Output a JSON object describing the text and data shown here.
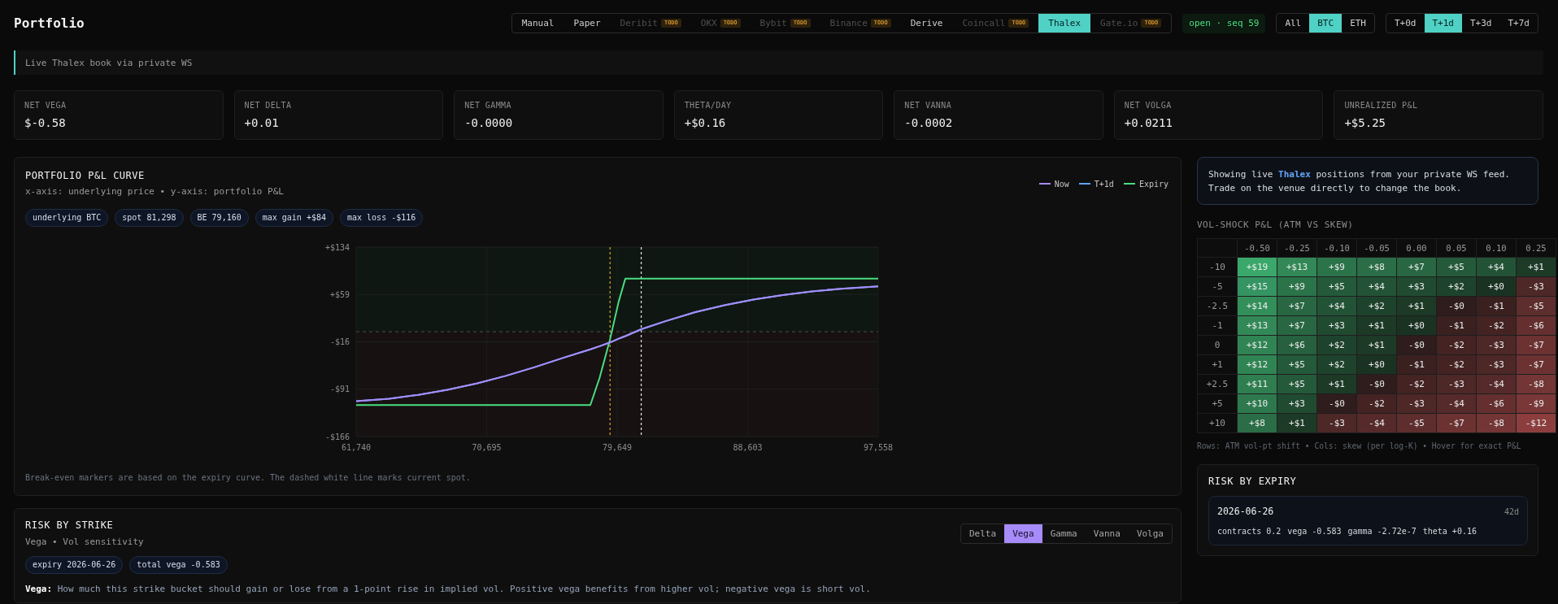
{
  "header": {
    "title": "Portfolio",
    "venues": [
      {
        "label": "Manual",
        "disabled": false,
        "selected": false
      },
      {
        "label": "Paper",
        "disabled": false,
        "selected": false
      },
      {
        "label": "Deribit",
        "badge": "TODO",
        "disabled": true,
        "selected": false
      },
      {
        "label": "OKX",
        "badge": "TODO",
        "disabled": true,
        "selected": false
      },
      {
        "label": "Bybit",
        "badge": "TODO",
        "disabled": true,
        "selected": false
      },
      {
        "label": "Binance",
        "badge": "TODO",
        "disabled": true,
        "selected": false
      },
      {
        "label": "Derive",
        "disabled": false,
        "selected": false
      },
      {
        "label": "Coincall",
        "badge": "TODO",
        "disabled": true,
        "selected": false
      },
      {
        "label": "Thalex",
        "disabled": false,
        "selected": true
      },
      {
        "label": "Gate.io",
        "badge": "TODO",
        "disabled": true,
        "selected": false
      }
    ],
    "status": "open · seq 59",
    "underlyings": [
      {
        "label": "All",
        "selected": false
      },
      {
        "label": "BTC",
        "selected": true
      },
      {
        "label": "ETH",
        "selected": false
      }
    ],
    "horizons": [
      {
        "label": "T+0d",
        "selected": false
      },
      {
        "label": "T+1d",
        "selected": true
      },
      {
        "label": "T+3d",
        "selected": false
      },
      {
        "label": "T+7d",
        "selected": false
      }
    ]
  },
  "banner": {
    "text": "Live Thalex book via private WS"
  },
  "stats": [
    {
      "label": "NET VEGA",
      "value": "$-0.58"
    },
    {
      "label": "NET DELTA",
      "value": "+0.01"
    },
    {
      "label": "NET GAMMA",
      "value": "-0.0000"
    },
    {
      "label": "THETA/DAY",
      "value": "+$0.16"
    },
    {
      "label": "NET VANNA",
      "value": "-0.0002"
    },
    {
      "label": "NET VOLGA",
      "value": "+0.0211"
    },
    {
      "label": "UNREALIZED P&L",
      "value": "+$5.25"
    }
  ],
  "pnl_curve": {
    "title": "PORTFOLIO P&L CURVE",
    "subtitle": "x-axis: underlying price • y-axis: portfolio P&L",
    "chips": [
      "underlying BTC",
      "spot 81,298",
      "BE 79,160",
      "max gain +$84",
      "max loss -$116"
    ],
    "chart_data": {
      "type": "line",
      "x": [
        61740,
        64000,
        66000,
        68000,
        70000,
        72000,
        74000,
        76000,
        77808,
        78444,
        79160,
        79744,
        80207,
        81298,
        83000,
        85000,
        87000,
        89000,
        91000,
        93000,
        95000,
        97558
      ],
      "series": [
        {
          "name": "Now",
          "color": "#a78bfa",
          "values": [
            -110,
            -106,
            -100,
            -92,
            -82,
            -70,
            -56,
            -41,
            -28,
            -23,
            -17,
            -11,
            -7,
            4,
            17,
            31,
            42,
            51,
            58,
            64,
            68,
            72
          ]
        },
        {
          "name": "T+1d",
          "color": "#60a5fa",
          "values": [
            -110,
            -106,
            -100,
            -92,
            -82,
            -70,
            -56,
            -41,
            -28,
            -23,
            -17,
            -11,
            -7,
            4,
            17,
            31,
            42,
            51,
            58,
            64,
            68,
            72
          ]
        },
        {
          "name": "Expiry",
          "color": "#4ade80",
          "values": [
            -116,
            -116,
            -116,
            -116,
            -116,
            -116,
            -116,
            -116,
            -116,
            -73,
            -12,
            47,
            84,
            84,
            84,
            84,
            84,
            84,
            84,
            84,
            84,
            84
          ]
        }
      ],
      "xlim": [
        61740,
        97558
      ],
      "ylim": [
        -166,
        134
      ],
      "xticks": [
        {
          "value": 61740,
          "label": "61,740"
        },
        {
          "value": 70695,
          "label": "70,695"
        },
        {
          "value": 79649,
          "label": "79,649"
        },
        {
          "value": 88603,
          "label": "88,603"
        },
        {
          "value": 97558,
          "label": "97,558"
        }
      ],
      "yticks": [
        {
          "value": 134,
          "label": "+$134"
        },
        {
          "value": 59,
          "label": "+$59"
        },
        {
          "value": -16,
          "label": "-$16"
        },
        {
          "value": -91,
          "label": "-$91"
        },
        {
          "value": -166,
          "label": "-$166"
        }
      ],
      "grid": true,
      "ref_lines": [
        {
          "axis": "y",
          "value": 0,
          "color": "#4d4d4d"
        },
        {
          "axis": "x",
          "value": 79160,
          "color": "#d4a72c"
        },
        {
          "axis": "x",
          "value": 81298,
          "color": "#e8e8e8"
        }
      ]
    },
    "note": "Break-even markers are based on the expiry curve. The dashed white line marks current spot."
  },
  "risk_by_strike": {
    "title": "RISK BY STRIKE",
    "subtitle": "Vega • Vol sensitivity",
    "tabs": [
      {
        "label": "Delta",
        "selected": false
      },
      {
        "label": "Vega",
        "selected": true
      },
      {
        "label": "Gamma",
        "selected": false
      },
      {
        "label": "Vanna",
        "selected": false
      },
      {
        "label": "Volga",
        "selected": false
      }
    ],
    "chips": [
      "expiry 2026-06-26",
      "total vega -0.583"
    ],
    "description": "**Vega:** How much this strike bucket should gain or lose from a 1-point rise in implied vol. Positive vega benefits from higher vol; negative vega is short vol."
  },
  "info": {
    "text": "Showing live **Thalex** positions from your private WS feed. Trade on the venue directly to change the book."
  },
  "vol_shock": {
    "title": "VOL-SHOCK P&L (ATM VS SKEW)",
    "columns": [
      "-0.50",
      "-0.25",
      "-0.10",
      "-0.05",
      "0.00",
      "0.05",
      "0.10",
      "0.25"
    ],
    "rows": [
      {
        "label": "-10",
        "cells": [
          {
            "value": "+$19",
            "color": "#3aa86a"
          },
          {
            "value": "+$13",
            "color": "#328957"
          },
          {
            "value": "+$9",
            "color": "#2b7349"
          },
          {
            "value": "+$8",
            "color": "#2a6d46"
          },
          {
            "value": "+$7",
            "color": "#286742"
          },
          {
            "value": "+$5",
            "color": "#245a3a"
          },
          {
            "value": "+$4",
            "color": "#235336"
          },
          {
            "value": "+$1",
            "color": "#1c3a26"
          }
        ]
      },
      {
        "label": "-5",
        "cells": [
          {
            "value": "+$15",
            "color": "#349462"
          },
          {
            "value": "+$9",
            "color": "#2b7349"
          },
          {
            "value": "+$5",
            "color": "#245a3a"
          },
          {
            "value": "+$4",
            "color": "#235336"
          },
          {
            "value": "+$3",
            "color": "#204b31"
          },
          {
            "value": "+$2",
            "color": "#1e432c"
          },
          {
            "value": "+$0",
            "color": "#1a3222"
          },
          {
            "value": "-$3",
            "color": "#4e2727"
          }
        ]
      },
      {
        "label": "-2.5",
        "cells": [
          {
            "value": "+$14",
            "color": "#338f5a"
          },
          {
            "value": "+$7",
            "color": "#286742"
          },
          {
            "value": "+$4",
            "color": "#235336"
          },
          {
            "value": "+$2",
            "color": "#1e432c"
          },
          {
            "value": "+$1",
            "color": "#1c3a26"
          },
          {
            "value": "-$0",
            "color": "#2f1c1c"
          },
          {
            "value": "-$1",
            "color": "#3b2020"
          },
          {
            "value": "-$5",
            "color": "#5e2d2d"
          }
        ]
      },
      {
        "label": "-1",
        "cells": [
          {
            "value": "+$13",
            "color": "#328957"
          },
          {
            "value": "+$7",
            "color": "#286742"
          },
          {
            "value": "+$3",
            "color": "#204b31"
          },
          {
            "value": "+$1",
            "color": "#1c3a26"
          },
          {
            "value": "+$0",
            "color": "#1a3222"
          },
          {
            "value": "-$1",
            "color": "#3b2020"
          },
          {
            "value": "-$2",
            "color": "#452323"
          },
          {
            "value": "-$6",
            "color": "#652f2f"
          }
        ]
      },
      {
        "label": "0",
        "cells": [
          {
            "value": "+$12",
            "color": "#308454"
          },
          {
            "value": "+$6",
            "color": "#26603e"
          },
          {
            "value": "+$2",
            "color": "#1e432c"
          },
          {
            "value": "+$1",
            "color": "#1c3a26"
          },
          {
            "value": "-$0",
            "color": "#2f1c1c"
          },
          {
            "value": "-$2",
            "color": "#452323"
          },
          {
            "value": "-$3",
            "color": "#4e2727"
          },
          {
            "value": "-$7",
            "color": "#6c3232"
          }
        ]
      },
      {
        "label": "+1",
        "cells": [
          {
            "value": "+$12",
            "color": "#308454"
          },
          {
            "value": "+$5",
            "color": "#245a3a"
          },
          {
            "value": "+$2",
            "color": "#1e432c"
          },
          {
            "value": "+$0",
            "color": "#1a3222"
          },
          {
            "value": "-$1",
            "color": "#3b2020"
          },
          {
            "value": "-$2",
            "color": "#452323"
          },
          {
            "value": "-$3",
            "color": "#4e2727"
          },
          {
            "value": "-$7",
            "color": "#6c3232"
          }
        ]
      },
      {
        "label": "+2.5",
        "cells": [
          {
            "value": "+$11",
            "color": "#2f7e50"
          },
          {
            "value": "+$5",
            "color": "#245a3a"
          },
          {
            "value": "+$1",
            "color": "#1c3a26"
          },
          {
            "value": "-$0",
            "color": "#2f1c1c"
          },
          {
            "value": "-$2",
            "color": "#452323"
          },
          {
            "value": "-$3",
            "color": "#4e2727"
          },
          {
            "value": "-$4",
            "color": "#562a2a"
          },
          {
            "value": "-$8",
            "color": "#733535"
          }
        ]
      },
      {
        "label": "+5",
        "cells": [
          {
            "value": "+$10",
            "color": "#2d794d"
          },
          {
            "value": "+$3",
            "color": "#204b31"
          },
          {
            "value": "-$0",
            "color": "#2f1c1c"
          },
          {
            "value": "-$2",
            "color": "#452323"
          },
          {
            "value": "-$3",
            "color": "#4e2727"
          },
          {
            "value": "-$4",
            "color": "#562a2a"
          },
          {
            "value": "-$6",
            "color": "#652f2f"
          },
          {
            "value": "-$9",
            "color": "#793737"
          }
        ]
      },
      {
        "label": "+10",
        "cells": [
          {
            "value": "+$8",
            "color": "#2a6d46"
          },
          {
            "value": "+$1",
            "color": "#1c3a26"
          },
          {
            "value": "-$3",
            "color": "#4e2727"
          },
          {
            "value": "-$4",
            "color": "#562a2a"
          },
          {
            "value": "-$5",
            "color": "#5e2d2d"
          },
          {
            "value": "-$7",
            "color": "#6c3232"
          },
          {
            "value": "-$8",
            "color": "#733535"
          },
          {
            "value": "-$12",
            "color": "#8c3e3e"
          }
        ]
      }
    ],
    "footnote": "Rows: ATM vol-pt shift • Cols: skew (per log-K) • Hover for exact P&L"
  },
  "risk_by_expiry": {
    "title": "RISK BY EXPIRY",
    "expiries": [
      {
        "date": "2026-06-26",
        "days": "42d",
        "stats": [
          {
            "label": "contracts",
            "value": "0.2"
          },
          {
            "label": "vega",
            "value": "-0.583"
          },
          {
            "label": "gamma",
            "value": "-2.72e-7"
          },
          {
            "label": "theta",
            "value": "+0.16"
          }
        ]
      }
    ]
  }
}
